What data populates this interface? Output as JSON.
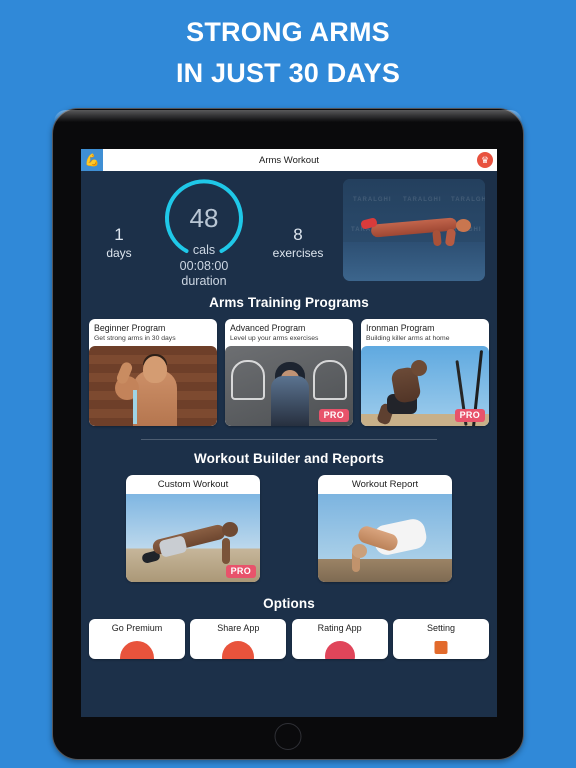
{
  "headline": {
    "line1": "STRONG ARMS",
    "line2": "IN JUST 30 DAYS"
  },
  "colors": {
    "backdrop": "#3089d8",
    "screen_bg": "#1c3049",
    "accent_cyan": "#1fc8e8",
    "crown_red": "#e8523f",
    "pro_pink": "#e8536b"
  },
  "titlebar": {
    "app_icon": "flexed-biceps-icon",
    "title": "Arms Workout",
    "premium_icon": "crown-icon"
  },
  "stats": {
    "days_value": "1",
    "days_label": "days",
    "calories_value": "48",
    "calories_label": "cals",
    "duration_value": "00:08:00",
    "duration_label": "duration",
    "exercises_value": "8",
    "exercises_label": "exercises",
    "hero_watermark": "TARALGHI"
  },
  "programs_section": {
    "title": "Arms Training Programs",
    "cards": [
      {
        "title": "Beginner Program",
        "subtitle": "Get strong arms in 30 days",
        "badge": ""
      },
      {
        "title": "Advanced Program",
        "subtitle": "Level up your arms exercises",
        "badge": "PRO"
      },
      {
        "title": "Ironman Program",
        "subtitle": "Building killer arms at home",
        "badge": "PRO"
      }
    ]
  },
  "builder_section": {
    "title": "Workout Builder and Reports",
    "cards": [
      {
        "title": "Custom Workout",
        "badge": "PRO"
      },
      {
        "title": "Workout Report",
        "badge": ""
      }
    ]
  },
  "options_section": {
    "title": "Options",
    "items": [
      {
        "label": "Go Premium",
        "icon": "crown-circle-icon"
      },
      {
        "label": "Share App",
        "icon": "share-circle-icon"
      },
      {
        "label": "Rating App",
        "icon": "star-circle-icon"
      },
      {
        "label": "Setting",
        "icon": "gear-square-icon"
      }
    ]
  }
}
